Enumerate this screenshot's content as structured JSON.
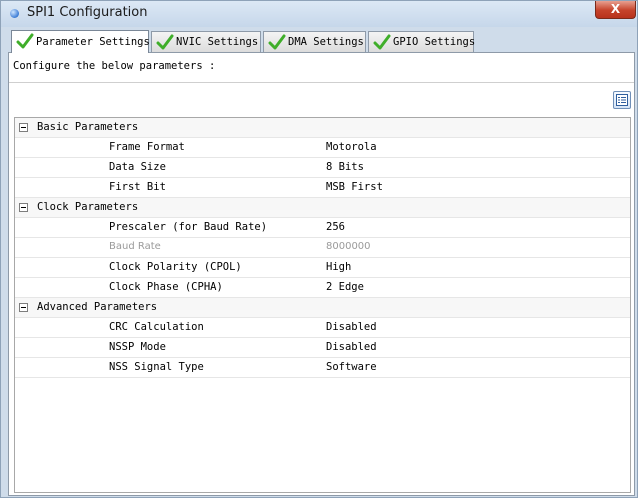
{
  "window": {
    "title": "SPI1 Configuration",
    "close_label": "X"
  },
  "tabs": [
    {
      "label": "Parameter Settings",
      "active": true
    },
    {
      "label": "NVIC Settings"
    },
    {
      "label": "DMA Settings"
    },
    {
      "label": "GPIO Settings"
    }
  ],
  "panel": {
    "description": "Configure the below parameters :"
  },
  "groups": [
    {
      "label": "Basic Parameters",
      "params": [
        {
          "name": "Frame Format",
          "value": "Motorola"
        },
        {
          "name": "Data Size",
          "value": "8 Bits"
        },
        {
          "name": "First Bit",
          "value": "MSB First"
        }
      ]
    },
    {
      "label": "Clock Parameters",
      "params": [
        {
          "name": "Prescaler (for Baud Rate)",
          "value": "256"
        },
        {
          "name": "Baud Rate",
          "value": "8000000"
        },
        {
          "name": "Clock Polarity (CPOL)",
          "value": "High"
        },
        {
          "name": "Clock Phase (CPHA)",
          "value": "2 Edge"
        }
      ]
    },
    {
      "label": "Advanced Parameters",
      "params": [
        {
          "name": "CRC Calculation",
          "value": "Disabled"
        },
        {
          "name": "NSSP Mode",
          "value": "Disabled"
        },
        {
          "name": "NSS Signal Type",
          "value": "Software"
        }
      ]
    }
  ],
  "icons": {
    "tab_check": "checkmark-icon",
    "list_view": "list-view-icon",
    "app": "app-icon",
    "group_toggle": "collapse-minus-icon"
  },
  "colors": {
    "check_green": "#3fae2a",
    "disabled_text": "#9a9a9a",
    "close_red": "#c5422a"
  }
}
